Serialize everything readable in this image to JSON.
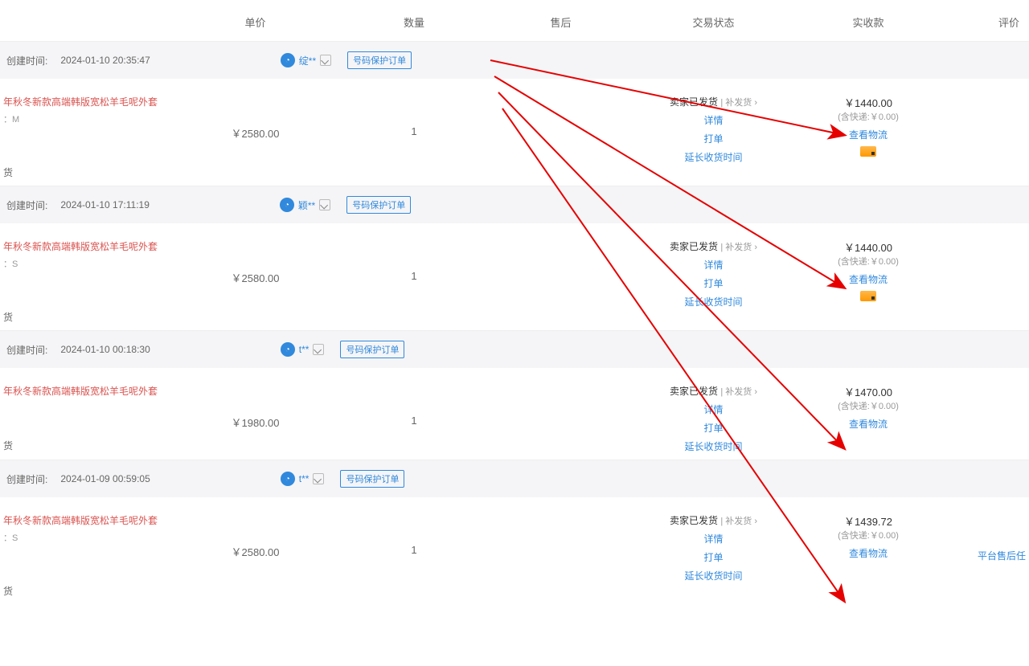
{
  "headers": {
    "price": "单价",
    "qty": "数量",
    "aftersale": "售后",
    "status": "交易状态",
    "payment": "实收款",
    "review": "评价"
  },
  "create_time_label": "创建时间:",
  "protect_label": "号码保护订单",
  "shipped_label": "卖家已发货",
  "supply_label": "补发货",
  "detail_label": "详情",
  "print_label": "打单",
  "extend_label": "延长收货时间",
  "logistics_label": "查看物流",
  "ship_method_label": "货",
  "orders": [
    {
      "create_time": "2024-01-10 20:35:47",
      "buyer": "绽**",
      "title": "年秋冬新款高端韩版宽松羊毛呢外套",
      "sku": "：M",
      "unit_price": "￥2580.00",
      "qty": "1",
      "paid": "￥1440.00",
      "ship_fee": "(含快递:￥0.00)",
      "show_card": true,
      "review": ""
    },
    {
      "create_time": "2024-01-10 17:11:19",
      "buyer": "颖**",
      "title": "年秋冬新款高端韩版宽松羊毛呢外套",
      "sku": "：S",
      "unit_price": "￥2580.00",
      "qty": "1",
      "paid": "￥1440.00",
      "ship_fee": "(含快递:￥0.00)",
      "show_card": true,
      "review": ""
    },
    {
      "create_time": "2024-01-10 00:18:30",
      "buyer": "t**",
      "title": "年秋冬新款高端韩版宽松羊毛呢外套",
      "sku": "",
      "unit_price": "￥1980.00",
      "qty": "1",
      "paid": "￥1470.00",
      "ship_fee": "(含快递:￥0.00)",
      "show_card": false,
      "review": ""
    },
    {
      "create_time": "2024-01-09 00:59:05",
      "buyer": "t**",
      "title": "年秋冬新款高端韩版宽松羊毛呢外套",
      "sku": "：S",
      "unit_price": "￥2580.00",
      "qty": "1",
      "paid": "￥1439.72",
      "ship_fee": "(含快递:￥0.00)",
      "show_card": false,
      "review": "平台售后任"
    }
  ]
}
